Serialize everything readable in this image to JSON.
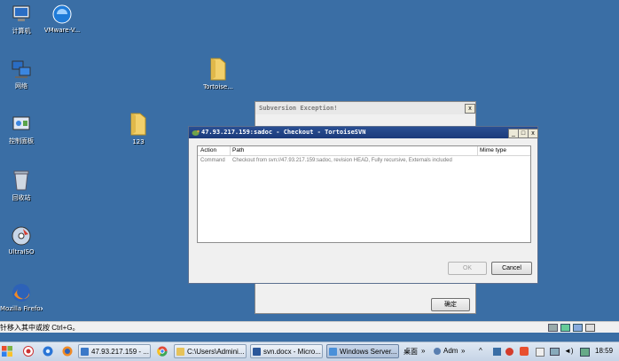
{
  "desktop": {
    "icons": [
      {
        "label": "计算机",
        "icon": "computer-icon"
      },
      {
        "label": "VMware-V...",
        "icon": "vmware-icon"
      },
      {
        "label": "网络",
        "icon": "network-icon"
      },
      {
        "label": "Tortoise...",
        "icon": "folder-icon"
      },
      {
        "label": "控制面板",
        "icon": "control-panel-icon"
      },
      {
        "label": "123",
        "icon": "folder-icon"
      },
      {
        "label": "回收站",
        "icon": "recycle-bin-icon"
      },
      {
        "label": "UltraISO",
        "icon": "ultraiso-icon"
      },
      {
        "label": "Mozilla Firefox",
        "icon": "firefox-icon"
      }
    ]
  },
  "exception_dialog": {
    "title": "Subversion Exception!",
    "close": "x",
    "ok_label": "确定"
  },
  "checkout_dialog": {
    "title": "47.93.217.159:sadoc - Checkout - TortoiseSVN",
    "controls": {
      "minimize": "_",
      "maximize": "□",
      "close": "x"
    },
    "columns": [
      "Action",
      "Path",
      "Mime type"
    ],
    "rows": [
      {
        "action": "Command",
        "path": "Checkout from svn://47.93.217.159:sadoc, revision HEAD, Fully recursive, Externals included",
        "mime": ""
      }
    ],
    "ok_label": "OK",
    "cancel_label": "Cancel"
  },
  "ie_statusbar": {
    "text": "针移入其中或按 Ctrl+G。"
  },
  "taskbar": {
    "windows": [
      {
        "label": "47.93.217.159 - ...",
        "icon_color": "#3a78c8"
      },
      {
        "label": "C:\\Users\\Admini...",
        "icon_color": "#e6c25a"
      },
      {
        "label": "svn.docx - Micro...",
        "icon_color": "#2b579a"
      },
      {
        "label": "Windows Server...",
        "icon_color": "#4a90d9"
      }
    ],
    "tray": {
      "desktop_label": "桌面",
      "user_label": "Adm",
      "time": "18:59"
    },
    "colors": {
      "accent": "#3a6ea5",
      "title_active": "#1b3a7a"
    }
  }
}
